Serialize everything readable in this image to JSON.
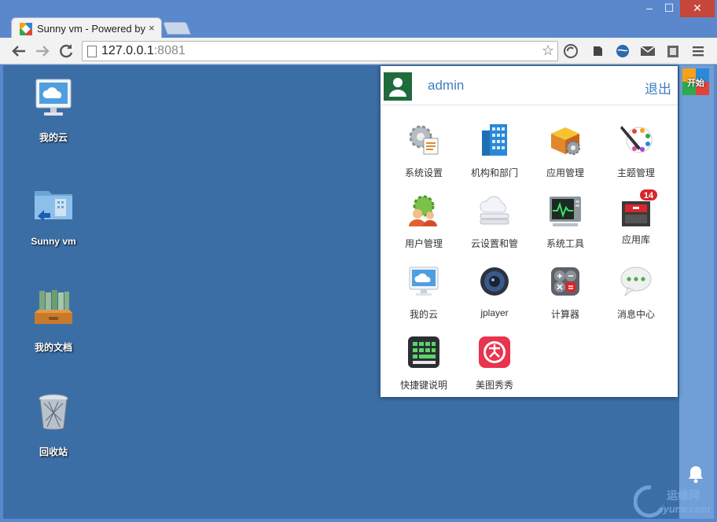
{
  "browser": {
    "tab_title": "Sunny vm - Powered by",
    "close_glyph": "×",
    "url_host": "127.0.0.1",
    "url_port": ":8081",
    "window_min": "–",
    "window_max": "☐",
    "window_close": "✕"
  },
  "desktop": {
    "icons": [
      {
        "label": "我的云",
        "icon": "cloud-monitor-icon"
      },
      {
        "label": "Sunny vm",
        "icon": "folder-building-icon"
      },
      {
        "label": "我的文档",
        "icon": "documents-tray-icon"
      },
      {
        "label": "回收站",
        "icon": "recycle-bin-icon"
      }
    ]
  },
  "dock": {
    "start_label": "开始"
  },
  "menu": {
    "username": "admin",
    "logout": "退出",
    "apps": [
      {
        "label": "系统设置",
        "icon": "gear-settings-icon"
      },
      {
        "label": "机构和部门",
        "icon": "building-icon"
      },
      {
        "label": "应用管理",
        "icon": "app-box-gear-icon"
      },
      {
        "label": "主题管理",
        "icon": "paint-palette-icon"
      },
      {
        "label": "用户管理",
        "icon": "users-gear-icon"
      },
      {
        "label": "云设置和管",
        "icon": "cloud-server-icon"
      },
      {
        "label": "系统工具",
        "icon": "monitor-pulse-icon"
      },
      {
        "label": "应用库",
        "icon": "cabinet-icon",
        "badge": "14"
      },
      {
        "label": "我的云",
        "icon": "cloud-monitor-icon"
      },
      {
        "label": "jplayer",
        "icon": "speaker-icon"
      },
      {
        "label": "计算器",
        "icon": "calculator-icon"
      },
      {
        "label": "消息中心",
        "icon": "chat-bubble-icon"
      },
      {
        "label": "快捷键说明",
        "icon": "keyboard-icon"
      },
      {
        "label": "美图秀秀",
        "icon": "meitu-icon"
      }
    ]
  },
  "watermark": {
    "line1": "运维网",
    "line2": "iyunv.com"
  },
  "colors": {
    "desktop_bg": "#3c6ea6",
    "frame": "#5b88cc",
    "accent_text": "#3f7fc0",
    "close_red": "#c7463b"
  }
}
